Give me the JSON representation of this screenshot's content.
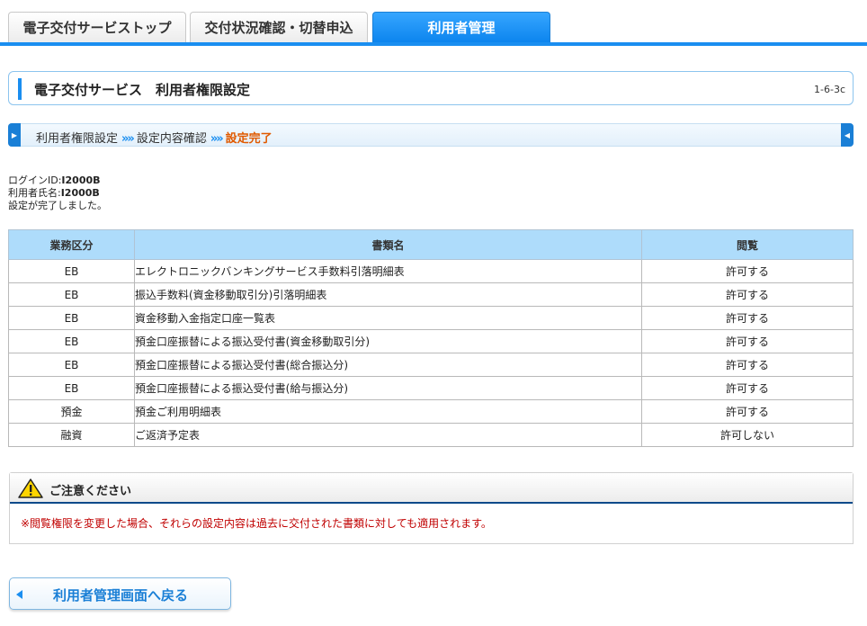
{
  "tabs": [
    {
      "label": "電子交付サービストップ",
      "active": false
    },
    {
      "label": "交付状況確認・切替申込",
      "active": false
    },
    {
      "label": "利用者管理",
      "active": true
    }
  ],
  "header": {
    "title": "電子交付サービス　利用者権限設定",
    "code": "1-6-3c"
  },
  "steps": [
    {
      "label": "利用者権限設定"
    },
    {
      "label": "設定内容確認"
    },
    {
      "label": "設定完了",
      "current": true
    }
  ],
  "step_separator": "»»",
  "info": {
    "login_label": "ログインID:",
    "login_value": "I2000B",
    "user_label": "利用者氏名:",
    "user_value": "I2000B",
    "message": "設定が完了しました。"
  },
  "table": {
    "headers": [
      "業務区分",
      "書類名",
      "閲覧"
    ],
    "rows": [
      [
        "EB",
        "エレクトロニックバンキングサービス手数料引落明細表",
        "許可する"
      ],
      [
        "EB",
        "振込手数料(資金移動取引分)引落明細表",
        "許可する"
      ],
      [
        "EB",
        "資金移動入金指定口座一覧表",
        "許可する"
      ],
      [
        "EB",
        "預金口座振替による振込受付書(資金移動取引分)",
        "許可する"
      ],
      [
        "EB",
        "預金口座振替による振込受付書(総合振込分)",
        "許可する"
      ],
      [
        "EB",
        "預金口座振替による振込受付書(給与振込分)",
        "許可する"
      ],
      [
        "預金",
        "預金ご利用明細表",
        "許可する"
      ],
      [
        "融資",
        "ご返済予定表",
        "許可しない"
      ]
    ]
  },
  "notice": {
    "title": "ご注意ください",
    "text": "※閲覧権限を変更した場合、それらの設定内容は過去に交付された書類に対しても適用されます。",
    "icon": "warning-icon"
  },
  "back_button": {
    "label": "利用者管理画面へ戻る",
    "icon": "arrow-left-icon"
  },
  "colors": {
    "accent": "#1a8ef0",
    "current_step": "#e05a00",
    "notice_text": "#c00000",
    "table_header": "#aedcfb"
  }
}
